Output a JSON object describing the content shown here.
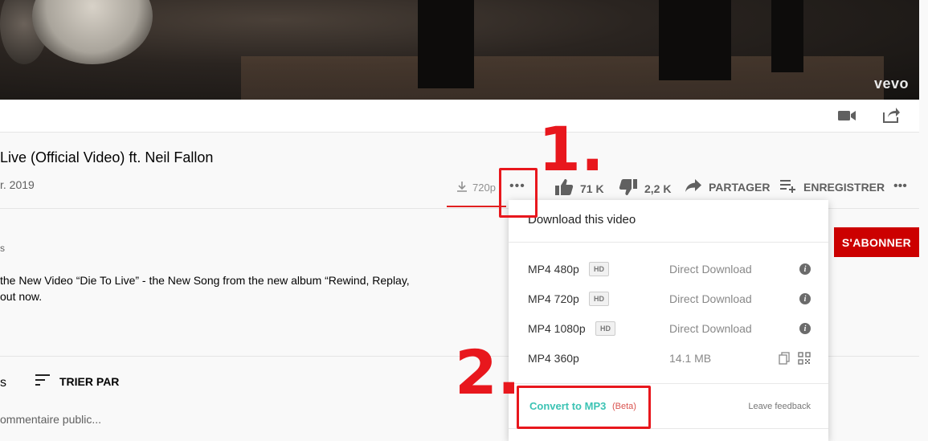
{
  "video": {
    "watermark": "vevo"
  },
  "player_controls": {
    "camera_icon": "video-camera-icon",
    "share_icon": "share-out-icon"
  },
  "video_info": {
    "title": "Live (Official Video) ft. Neil Fallon",
    "date": "r. 2019"
  },
  "actions": {
    "download_quality": "720p",
    "more": "•••",
    "likes": "71 K",
    "dislikes": "2,2 K",
    "share_label": "PARTAGER",
    "save_label": "ENREGISTRER",
    "more2": "•••"
  },
  "channel": {
    "subs_partial": "s",
    "subscribe_label": "S'ABONNER"
  },
  "description": {
    "line1": "the New Video “Die To Live” - the New Song from the new album “Rewind, Replay,",
    "line2": "out now."
  },
  "comments": {
    "count_partial": "s",
    "sort_label": "TRIER PAR",
    "input_placeholder": "ommentaire public..."
  },
  "download_panel": {
    "header": "Download this video",
    "rows": [
      {
        "format": "MP4 480p",
        "badge": "HD",
        "action": "Direct Download"
      },
      {
        "format": "MP4 720p",
        "badge": "HD",
        "action": "Direct Download"
      },
      {
        "format": "MP4 1080p",
        "badge": "HD",
        "action": "Direct Download"
      },
      {
        "format": "MP4 360p",
        "badge": "",
        "action": "14.1 MB"
      }
    ],
    "convert_label": "Convert to MP3",
    "beta_label": "(Beta)",
    "feedback_label": "Leave feedback"
  },
  "annotations": {
    "step1": "1.",
    "step2": "2."
  },
  "colors": {
    "annotation_red": "#e8171d",
    "subscribe_red": "#cc0000",
    "mp3_teal": "#3cc3b4"
  }
}
